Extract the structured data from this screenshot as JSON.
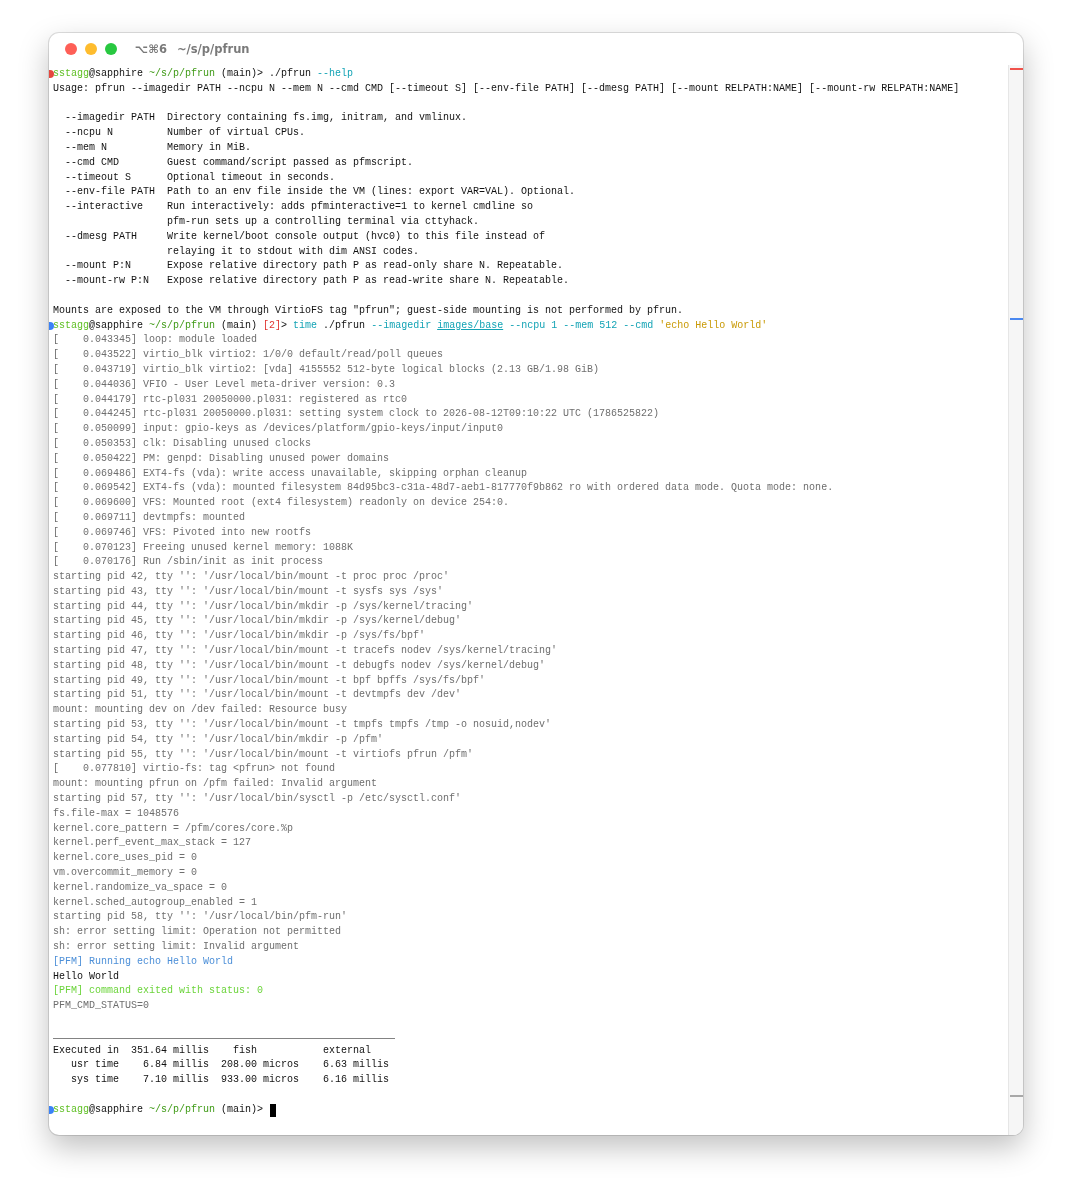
{
  "window": {
    "shortcut": "⌥⌘6",
    "title": "~/s/p/pfrun"
  },
  "lines": [
    {
      "kind": "prompt",
      "color": "#e5483f",
      "segments": [
        {
          "text": "sstagg",
          "kind": "user"
        },
        {
          "text": "@sapphire ",
          "kind": "plain"
        },
        {
          "text": "~/s/p/pfrun",
          "kind": "path"
        },
        {
          "text": " (main)> ./pfrun ",
          "kind": "plain"
        },
        {
          "text": "--help",
          "kind": "arg"
        }
      ]
    },
    {
      "kind": "text",
      "segments": [
        {
          "text": "Usage: pfrun --imagedir PATH --ncpu N --mem N --cmd CMD [--timeout S] [--env-file PATH] [--dmesg PATH] [--mount RELPATH:NAME] [--mount-rw RELPATH:NAME]",
          "kind": "plain"
        }
      ]
    },
    {
      "kind": "blank"
    },
    {
      "kind": "text",
      "segments": [
        {
          "text": "  --imagedir PATH  Directory containing fs.img, initram, and vmlinux.",
          "kind": "plain"
        }
      ]
    },
    {
      "kind": "text",
      "segments": [
        {
          "text": "  --ncpu N         Number of virtual CPUs.",
          "kind": "plain"
        }
      ]
    },
    {
      "kind": "text",
      "segments": [
        {
          "text": "  --mem N          Memory in MiB.",
          "kind": "plain"
        }
      ]
    },
    {
      "kind": "text",
      "segments": [
        {
          "text": "  --cmd CMD        Guest command/script passed as pfmscript.",
          "kind": "plain"
        }
      ]
    },
    {
      "kind": "text",
      "segments": [
        {
          "text": "  --timeout S      Optional timeout in seconds.",
          "kind": "plain"
        }
      ]
    },
    {
      "kind": "text",
      "segments": [
        {
          "text": "  --env-file PATH  Path to an env file inside the VM (lines: export VAR=VAL). Optional.",
          "kind": "plain"
        }
      ]
    },
    {
      "kind": "text",
      "segments": [
        {
          "text": "  --interactive    Run interactively: adds pfminteractive=1 to kernel cmdline so",
          "kind": "plain"
        }
      ]
    },
    {
      "kind": "text",
      "segments": [
        {
          "text": "                   pfm-run sets up a controlling terminal via cttyhack.",
          "kind": "plain"
        }
      ]
    },
    {
      "kind": "text",
      "segments": [
        {
          "text": "  --dmesg PATH     Write kernel/boot console output (hvc0) to this file instead of",
          "kind": "plain"
        }
      ]
    },
    {
      "kind": "text",
      "segments": [
        {
          "text": "                   relaying it to stdout with dim ANSI codes.",
          "kind": "plain"
        }
      ]
    },
    {
      "kind": "text",
      "segments": [
        {
          "text": "  --mount P:N      Expose relative directory path P as read-only share N. Repeatable.",
          "kind": "plain"
        }
      ]
    },
    {
      "kind": "text",
      "segments": [
        {
          "text": "  --mount-rw P:N   Expose relative directory path P as read-write share N. Repeatable.",
          "kind": "plain"
        }
      ]
    },
    {
      "kind": "blank"
    },
    {
      "kind": "text",
      "segments": [
        {
          "text": "Mounts are exposed to the VM through VirtioFS tag \"pfrun\"; guest-side mounting is not performed by pfrun.",
          "kind": "plain"
        }
      ]
    },
    {
      "kind": "prompt",
      "color": "#3b82f6",
      "segments": [
        {
          "text": "sstagg",
          "kind": "user"
        },
        {
          "text": "@sapphire ",
          "kind": "plain"
        },
        {
          "text": "~/s/p/pfrun",
          "kind": "path"
        },
        {
          "text": " (main) ",
          "kind": "plain"
        },
        {
          "text": "[2]",
          "kind": "error"
        },
        {
          "text": "> ",
          "kind": "plain"
        },
        {
          "text": "time",
          "kind": "arg"
        },
        {
          "text": " ./pfrun ",
          "kind": "plain"
        },
        {
          "text": "--imagedir ",
          "kind": "arg"
        },
        {
          "text": "images/base",
          "kind": "pathArg"
        },
        {
          "text": " --ncpu 1 --mem 512 --cmd ",
          "kind": "arg"
        },
        {
          "text": "'echo Hello World'",
          "kind": "string"
        }
      ]
    },
    {
      "kind": "text",
      "segments": [
        {
          "text": "[    0.043345] loop: module loaded",
          "kind": "dim"
        }
      ]
    },
    {
      "kind": "text",
      "segments": [
        {
          "text": "[    0.043522] virtio_blk virtio2: 1/0/0 default/read/poll queues",
          "kind": "dim"
        }
      ]
    },
    {
      "kind": "text",
      "segments": [
        {
          "text": "[    0.043719] virtio_blk virtio2: [vda] 4155552 512-byte logical blocks (2.13 GB/1.98 GiB)",
          "kind": "dim"
        }
      ]
    },
    {
      "kind": "text",
      "segments": [
        {
          "text": "[    0.044036] VFIO - User Level meta-driver version: 0.3",
          "kind": "dim"
        }
      ]
    },
    {
      "kind": "text",
      "segments": [
        {
          "text": "[    0.044179] rtc-pl031 20050000.pl031: registered as rtc0",
          "kind": "dim"
        }
      ]
    },
    {
      "kind": "text",
      "segments": [
        {
          "text": "[    0.044245] rtc-pl031 20050000.pl031: setting system clock to 2026-08-12T09:10:22 UTC (1786525822)",
          "kind": "dim"
        }
      ]
    },
    {
      "kind": "text",
      "segments": [
        {
          "text": "[    0.050099] input: gpio-keys as /devices/platform/gpio-keys/input/input0",
          "kind": "dim"
        }
      ]
    },
    {
      "kind": "text",
      "segments": [
        {
          "text": "[    0.050353] clk: Disabling unused clocks",
          "kind": "dim"
        }
      ]
    },
    {
      "kind": "text",
      "segments": [
        {
          "text": "[    0.050422] PM: genpd: Disabling unused power domains",
          "kind": "dim"
        }
      ]
    },
    {
      "kind": "text",
      "segments": [
        {
          "text": "[    0.069486] EXT4-fs (vda): write access unavailable, skipping orphan cleanup",
          "kind": "dim"
        }
      ]
    },
    {
      "kind": "text",
      "segments": [
        {
          "text": "[    0.069542] EXT4-fs (vda): mounted filesystem 84d95bc3-c31a-48d7-aeb1-817770f9b862 ro with ordered data mode. Quota mode: none.",
          "kind": "dim"
        }
      ]
    },
    {
      "kind": "text",
      "segments": [
        {
          "text": "[    0.069600] VFS: Mounted root (ext4 filesystem) readonly on device 254:0.",
          "kind": "dim"
        }
      ]
    },
    {
      "kind": "text",
      "segments": [
        {
          "text": "[    0.069711] devtmpfs: mounted",
          "kind": "dim"
        }
      ]
    },
    {
      "kind": "text",
      "segments": [
        {
          "text": "[    0.069746] VFS: Pivoted into new rootfs",
          "kind": "dim"
        }
      ]
    },
    {
      "kind": "text",
      "segments": [
        {
          "text": "[    0.070123] Freeing unused kernel memory: 1088K",
          "kind": "dim"
        }
      ]
    },
    {
      "kind": "text",
      "segments": [
        {
          "text": "[    0.070176] Run /sbin/init as init process",
          "kind": "dim"
        }
      ]
    },
    {
      "kind": "text",
      "segments": [
        {
          "text": "starting pid 42, tty '': '/usr/local/bin/mount -t proc proc /proc'",
          "kind": "dim"
        }
      ]
    },
    {
      "kind": "text",
      "segments": [
        {
          "text": "starting pid 43, tty '': '/usr/local/bin/mount -t sysfs sys /sys'",
          "kind": "dim"
        }
      ]
    },
    {
      "kind": "text",
      "segments": [
        {
          "text": "starting pid 44, tty '': '/usr/local/bin/mkdir -p /sys/kernel/tracing'",
          "kind": "dim"
        }
      ]
    },
    {
      "kind": "text",
      "segments": [
        {
          "text": "starting pid 45, tty '': '/usr/local/bin/mkdir -p /sys/kernel/debug'",
          "kind": "dim"
        }
      ]
    },
    {
      "kind": "text",
      "segments": [
        {
          "text": "starting pid 46, tty '': '/usr/local/bin/mkdir -p /sys/fs/bpf'",
          "kind": "dim"
        }
      ]
    },
    {
      "kind": "text",
      "segments": [
        {
          "text": "starting pid 47, tty '': '/usr/local/bin/mount -t tracefs nodev /sys/kernel/tracing'",
          "kind": "dim"
        }
      ]
    },
    {
      "kind": "text",
      "segments": [
        {
          "text": "starting pid 48, tty '': '/usr/local/bin/mount -t debugfs nodev /sys/kernel/debug'",
          "kind": "dim"
        }
      ]
    },
    {
      "kind": "text",
      "segments": [
        {
          "text": "starting pid 49, tty '': '/usr/local/bin/mount -t bpf bpffs /sys/fs/bpf'",
          "kind": "dim"
        }
      ]
    },
    {
      "kind": "text",
      "segments": [
        {
          "text": "starting pid 51, tty '': '/usr/local/bin/mount -t devtmpfs dev /dev'",
          "kind": "dim"
        }
      ]
    },
    {
      "kind": "text",
      "segments": [
        {
          "text": "mount: mounting dev on /dev failed: Resource busy",
          "kind": "dim"
        }
      ]
    },
    {
      "kind": "text",
      "segments": [
        {
          "text": "starting pid 53, tty '': '/usr/local/bin/mount -t tmpfs tmpfs /tmp -o nosuid,nodev'",
          "kind": "dim"
        }
      ]
    },
    {
      "kind": "text",
      "segments": [
        {
          "text": "starting pid 54, tty '': '/usr/local/bin/mkdir -p /pfm'",
          "kind": "dim"
        }
      ]
    },
    {
      "kind": "text",
      "segments": [
        {
          "text": "starting pid 55, tty '': '/usr/local/bin/mount -t virtiofs pfrun /pfm'",
          "kind": "dim"
        }
      ]
    },
    {
      "kind": "text",
      "segments": [
        {
          "text": "[    0.077810] virtio-fs: tag <pfrun> not found",
          "kind": "dim"
        }
      ]
    },
    {
      "kind": "text",
      "segments": [
        {
          "text": "mount: mounting pfrun on /pfm failed: Invalid argument",
          "kind": "dim"
        }
      ]
    },
    {
      "kind": "text",
      "segments": [
        {
          "text": "starting pid 57, tty '': '/usr/local/bin/sysctl -p /etc/sysctl.conf'",
          "kind": "dim"
        }
      ]
    },
    {
      "kind": "text",
      "segments": [
        {
          "text": "fs.file-max = 1048576",
          "kind": "dim"
        }
      ]
    },
    {
      "kind": "text",
      "segments": [
        {
          "text": "kernel.core_pattern = /pfm/cores/core.%p",
          "kind": "dim"
        }
      ]
    },
    {
      "kind": "text",
      "segments": [
        {
          "text": "kernel.perf_event_max_stack = 127",
          "kind": "dim"
        }
      ]
    },
    {
      "kind": "text",
      "segments": [
        {
          "text": "kernel.core_uses_pid = 0",
          "kind": "dim"
        }
      ]
    },
    {
      "kind": "text",
      "segments": [
        {
          "text": "vm.overcommit_memory = 0",
          "kind": "dim"
        }
      ]
    },
    {
      "kind": "text",
      "segments": [
        {
          "text": "kernel.randomize_va_space = 0",
          "kind": "dim"
        }
      ]
    },
    {
      "kind": "text",
      "segments": [
        {
          "text": "kernel.sched_autogroup_enabled = 1",
          "kind": "dim"
        }
      ]
    },
    {
      "kind": "text",
      "segments": [
        {
          "text": "starting pid 58, tty '': '/usr/local/bin/pfm-run'",
          "kind": "dim"
        }
      ]
    },
    {
      "kind": "text",
      "segments": [
        {
          "text": "sh: error setting limit: Operation not permitted",
          "kind": "dim"
        }
      ]
    },
    {
      "kind": "text",
      "segments": [
        {
          "text": "sh: error setting limit: Invalid argument",
          "kind": "dim"
        }
      ]
    },
    {
      "kind": "text",
      "segments": [
        {
          "text": "[PFM] Running echo Hello World",
          "kind": "info"
        }
      ]
    },
    {
      "kind": "text",
      "segments": [
        {
          "text": "Hello World",
          "kind": "plain"
        }
      ]
    },
    {
      "kind": "text",
      "segments": [
        {
          "text": "[PFM] command exited with status: 0",
          "kind": "success"
        }
      ]
    },
    {
      "kind": "text",
      "segments": [
        {
          "text": "PFM_CMD_STATUS=0",
          "kind": "dim"
        }
      ]
    },
    {
      "kind": "blank"
    },
    {
      "kind": "text",
      "segments": [
        {
          "text": "_________________________________________________________",
          "kind": "plain"
        }
      ]
    },
    {
      "kind": "text",
      "segments": [
        {
          "text": "Executed in  351.64 millis    fish           external",
          "kind": "plain"
        }
      ]
    },
    {
      "kind": "text",
      "segments": [
        {
          "text": "   usr time    6.84 millis  208.00 micros    6.63 millis",
          "kind": "plain"
        }
      ]
    },
    {
      "kind": "text",
      "segments": [
        {
          "text": "   sys time    7.10 millis  933.00 micros    6.16 millis",
          "kind": "plain"
        }
      ]
    },
    {
      "kind": "blank"
    },
    {
      "kind": "prompt",
      "color": "#3b82f6",
      "cursor": true,
      "segments": [
        {
          "text": "sstagg",
          "kind": "user"
        },
        {
          "text": "@sapphire ",
          "kind": "plain"
        },
        {
          "text": "~/s/p/pfrun",
          "kind": "path"
        },
        {
          "text": " (main)> ",
          "kind": "plain"
        }
      ]
    }
  ]
}
